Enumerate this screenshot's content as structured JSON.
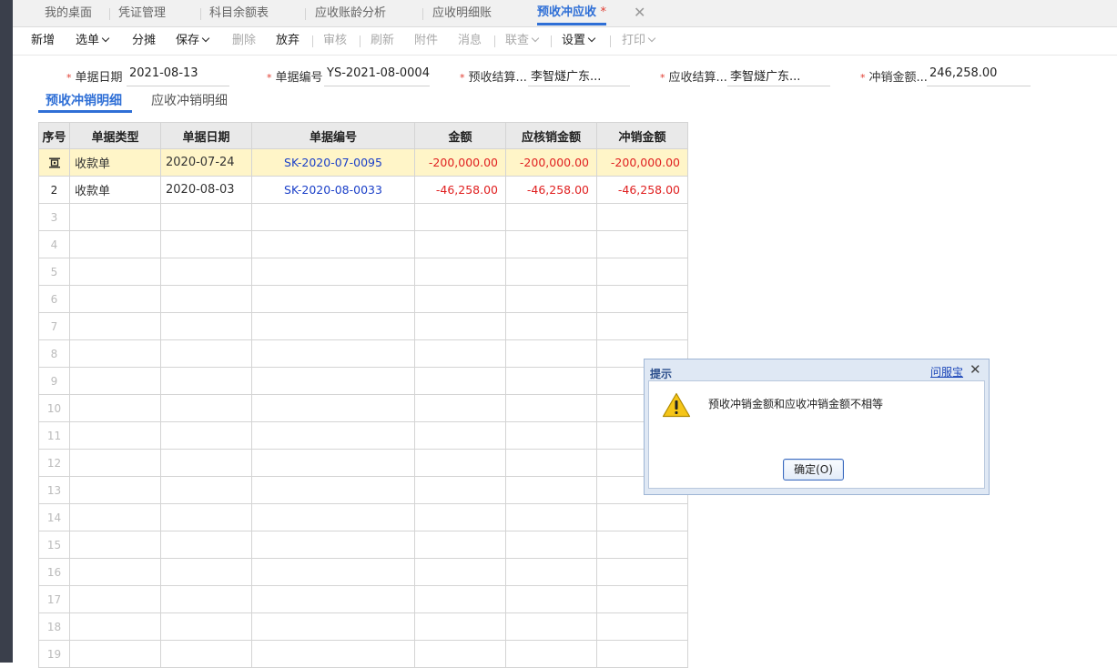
{
  "tabs": [
    {
      "label": "我的桌面"
    },
    {
      "label": "凭证管理"
    },
    {
      "label": "科目余额表"
    },
    {
      "label": "应收账龄分析"
    },
    {
      "label": "应收明细账"
    },
    {
      "label": "预收冲应收",
      "modified_mark": "*"
    }
  ],
  "toolbar": {
    "new": "新增",
    "select": "选单",
    "allocate": "分摊",
    "save": "保存",
    "delete": "删除",
    "discard": "放弃",
    "audit": "审核",
    "refresh": "刷新",
    "attachment": "附件",
    "message": "消息",
    "linked": "联查",
    "settings": "设置",
    "print": "打印"
  },
  "form": {
    "required_mark": "*",
    "bill_date_label": "单据日期",
    "bill_date": "2021-08-13",
    "bill_no_label": "单据编号",
    "bill_no": "YS-2021-08-0004",
    "prepay_settle_label": "预收结算...",
    "prepay_settle": "李智燧广东...",
    "receivable_settle_label": "应收结算...",
    "receivable_settle": "李智燧广东...",
    "writeoff_amount_label": "冲销金额...",
    "writeoff_amount": "246,258.00"
  },
  "subtabs": {
    "prepay_detail": "预收冲销明细",
    "receivable_detail": "应收冲销明细"
  },
  "grid": {
    "headers": [
      "序号",
      "单据类型",
      "单据日期",
      "单据编号",
      "金额",
      "应核销金额",
      "冲销金额"
    ],
    "rows": [
      {
        "no": "",
        "type": "收款单",
        "date": "2020-07-24",
        "code": "SK-2020-07-0095",
        "amount": "-200,000.00",
        "due": "-200,000.00",
        "writeoff": "-200,000.00"
      },
      {
        "no": "2",
        "type": "收款单",
        "date": "2020-08-03",
        "code": "SK-2020-08-0033",
        "amount": "-46,258.00",
        "due": "-46,258.00",
        "writeoff": "-46,258.00"
      }
    ],
    "empty_row_numbers": [
      "3",
      "4",
      "5",
      "6",
      "7",
      "8",
      "9",
      "10",
      "11",
      "12",
      "13",
      "14",
      "15",
      "16",
      "17",
      "18",
      "19"
    ]
  },
  "dialog": {
    "title": "提示",
    "help_link": "问服宝",
    "message": "预收冲销金额和应收冲销金额不相等",
    "ok_button": "确定(O)"
  },
  "colors": {
    "accent": "#2f6fd6",
    "negative_amount": "#e02020",
    "link": "#1a3fc8",
    "selected_row": "#fff5c8"
  }
}
